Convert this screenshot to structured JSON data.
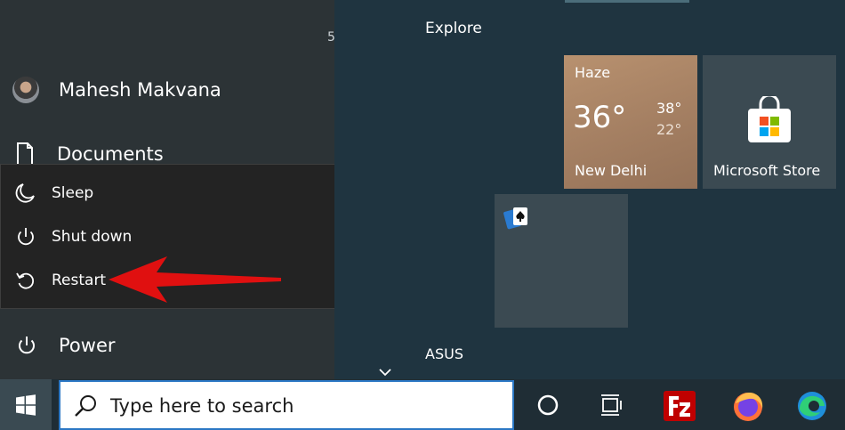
{
  "user": {
    "name": "Mahesh Makvana"
  },
  "left_menu": {
    "documents": "Documents",
    "power": "Power",
    "stray_glyph": "5"
  },
  "power_menu": [
    {
      "label": "Sleep",
      "icon": "moon-icon"
    },
    {
      "label": "Shut down",
      "icon": "power-icon"
    },
    {
      "label": "Restart",
      "icon": "restart-icon"
    }
  ],
  "groups": {
    "explore": "Explore",
    "asus": "ASUS"
  },
  "weather": {
    "condition": "Haze",
    "temp": "36°",
    "high": "38°",
    "low": "22°",
    "city": "New Delhi"
  },
  "store": {
    "label": "Microsoft Store"
  },
  "search": {
    "placeholder": "Type here to search"
  },
  "colors": {
    "accent_arrow": "#e01010",
    "search_border": "#2b77c4",
    "tile": "#3b4a52"
  }
}
